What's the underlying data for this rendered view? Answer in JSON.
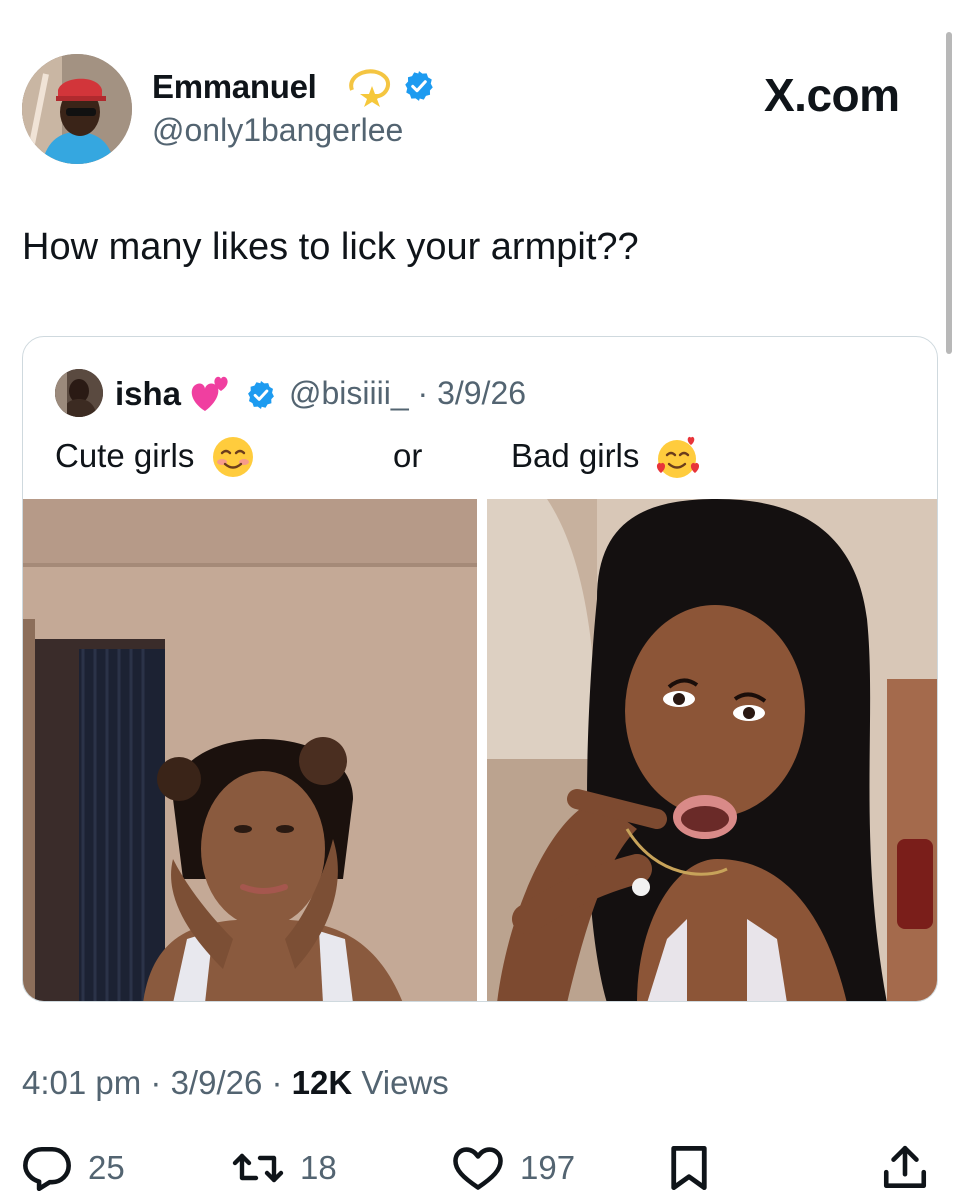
{
  "author": {
    "name": "Emmanuel",
    "handle": "@only1bangerlee",
    "verified": true,
    "name_emoji": "dizzy-star-emoji"
  },
  "watermark": "X.com",
  "tweet": {
    "text": "How many likes to lick your armpit??"
  },
  "quoted_tweet": {
    "name": "isha",
    "name_emoji": "two-hearts-emoji",
    "verified": true,
    "handle_date": "@bisiiii_ · 3/9/26",
    "text_part_1": "Cute girls",
    "text_emoji_1": "smiling-face-emoji",
    "text_part_2": "or",
    "text_part_3": "Bad girls",
    "text_emoji_2": "smiling-face-with-hearts-emoji",
    "images": [
      {
        "name": "photo-left",
        "desc_icon": "photo"
      },
      {
        "name": "photo-right",
        "desc_icon": "photo"
      }
    ]
  },
  "meta": {
    "time_date": "4:01 pm · 3/9/26 · ",
    "views_count": "12K",
    "views_label": " Views"
  },
  "actions": {
    "replies": "25",
    "reposts": "18",
    "likes": "197"
  },
  "colors": {
    "verified_blue": "#1d9bf0",
    "secondary_text": "#536471",
    "primary_text": "#0f1419",
    "border": "#cfd9de"
  }
}
